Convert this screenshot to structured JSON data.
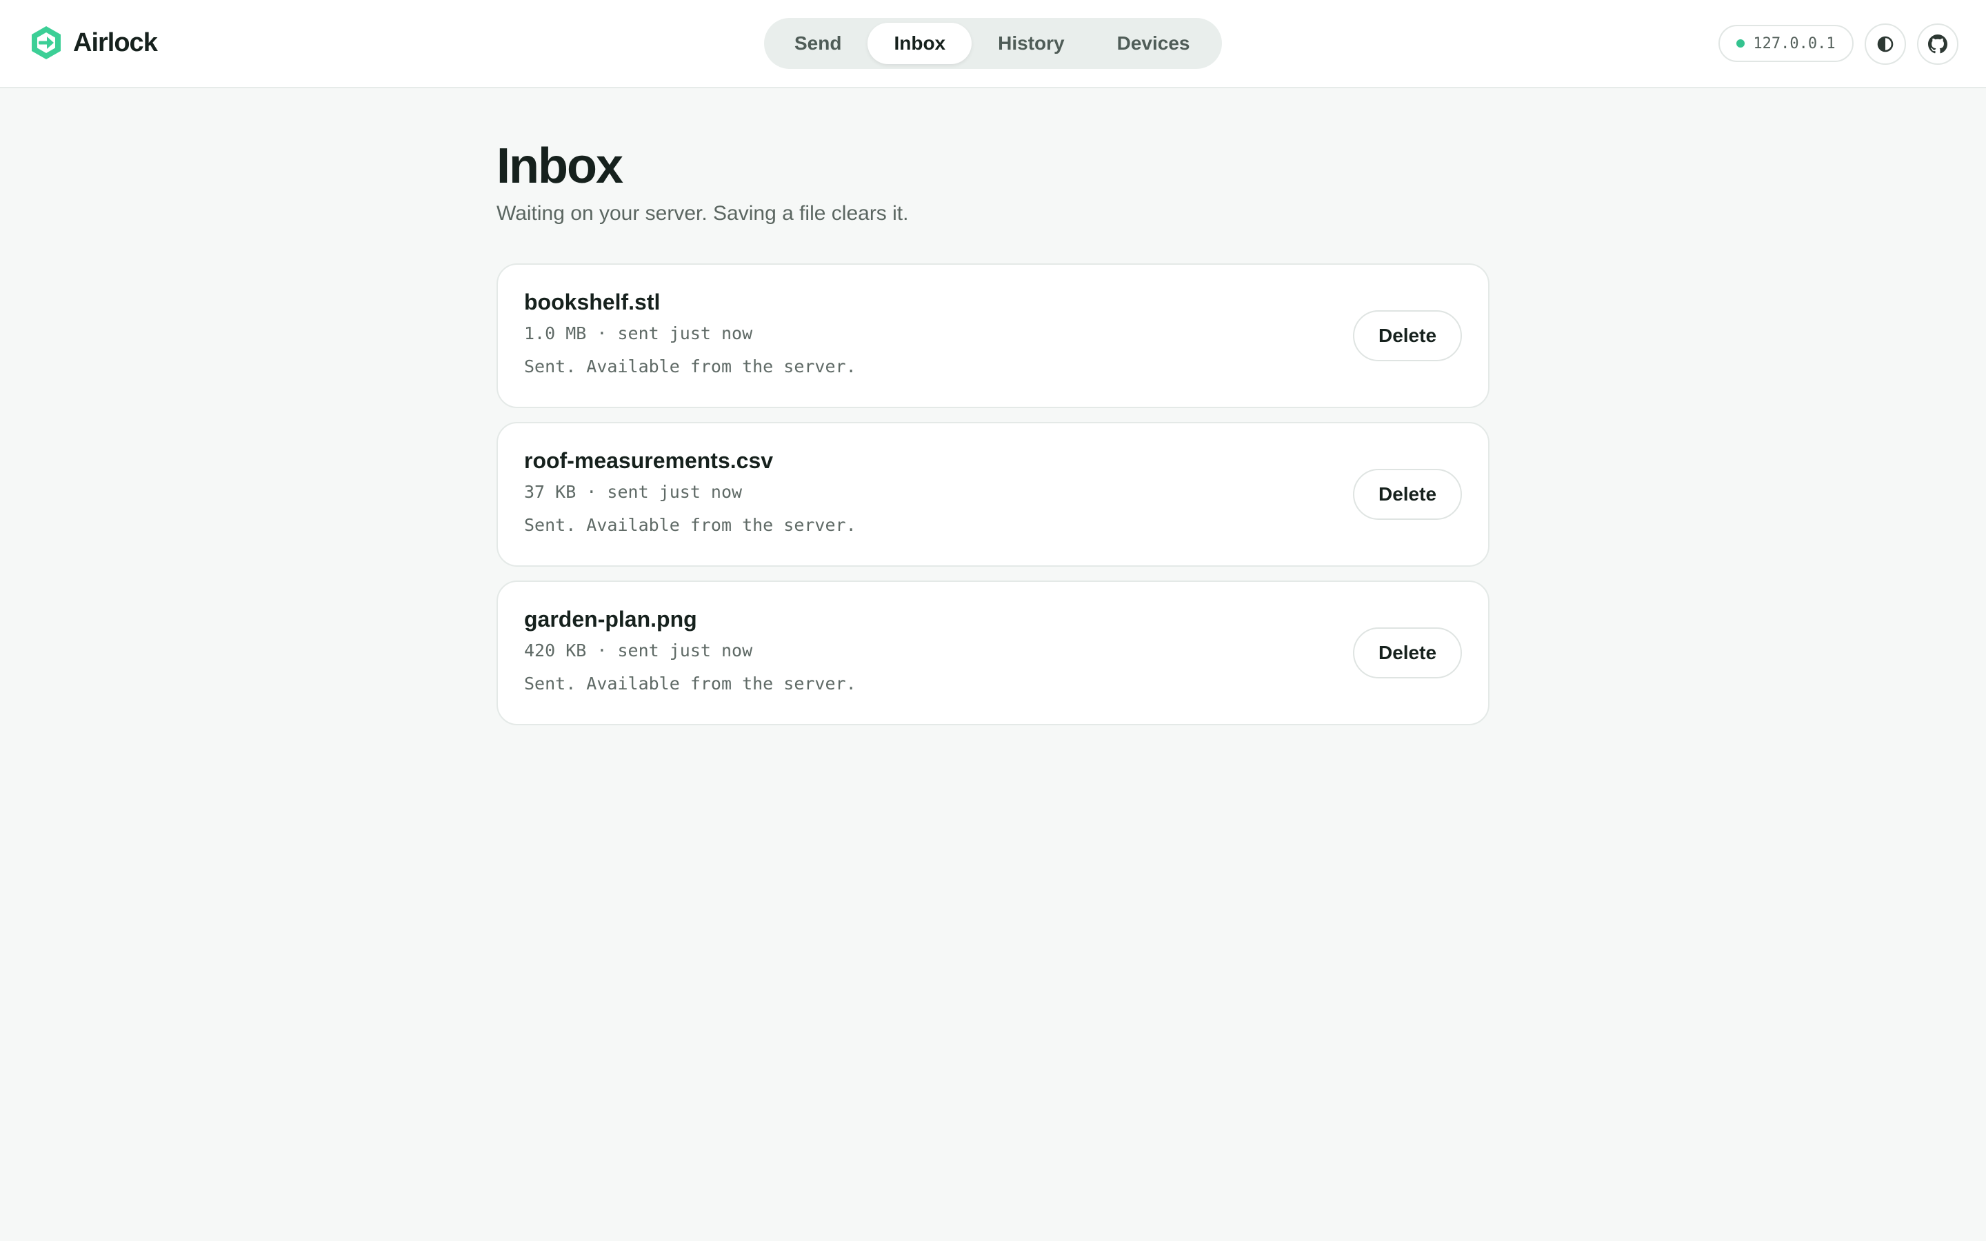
{
  "brand": {
    "name": "Airlock",
    "logo_icon": "airlock-logo-icon",
    "accent_color": "#3ccf96"
  },
  "nav": {
    "tabs": [
      {
        "label": "Send",
        "active": false
      },
      {
        "label": "Inbox",
        "active": true
      },
      {
        "label": "History",
        "active": false
      },
      {
        "label": "Devices",
        "active": false
      }
    ]
  },
  "header": {
    "server_address": "127.0.0.1",
    "status_color": "#34c38f",
    "theme_icon": "contrast-icon",
    "github_icon": "github-icon"
  },
  "main": {
    "title": "Inbox",
    "subtitle": "Waiting on your server. Saving a file clears it.",
    "files": [
      {
        "name": "bookshelf.stl",
        "meta": "1.0 MB · sent just now",
        "status": "Sent. Available from the server.",
        "delete_label": "Delete"
      },
      {
        "name": "roof-measurements.csv",
        "meta": "37 KB · sent just now",
        "status": "Sent. Available from the server.",
        "delete_label": "Delete"
      },
      {
        "name": "garden-plan.png",
        "meta": "420 KB · sent just now",
        "status": "Sent. Available from the server.",
        "delete_label": "Delete"
      }
    ]
  }
}
